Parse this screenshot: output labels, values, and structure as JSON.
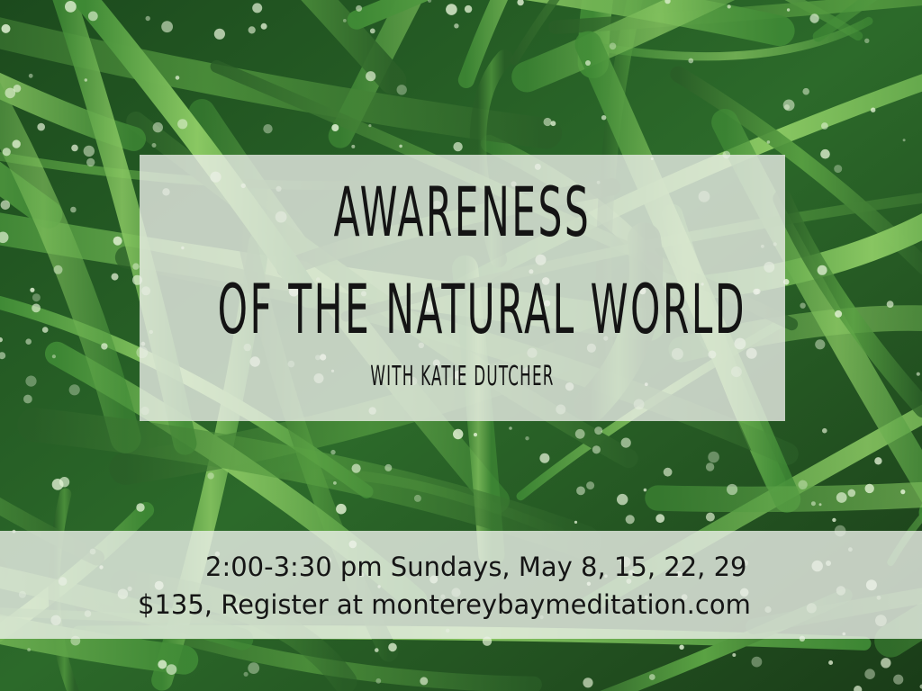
{
  "background": {
    "description_icon": "dewy-grass-photo",
    "colors": {
      "dark": "#123015",
      "mid": "#2f6b2a",
      "light": "#7bbf5a",
      "highlight": "#c8e6a8"
    }
  },
  "title": {
    "line1": "Awareness",
    "line2": "of the Natural World",
    "line3": "with Katie Dutcher"
  },
  "info": {
    "schedule": "2:00-3:30 pm Sundays, May 8, 15, 22, 29",
    "price_register": "$135, Register at montereybaymeditation.com"
  }
}
